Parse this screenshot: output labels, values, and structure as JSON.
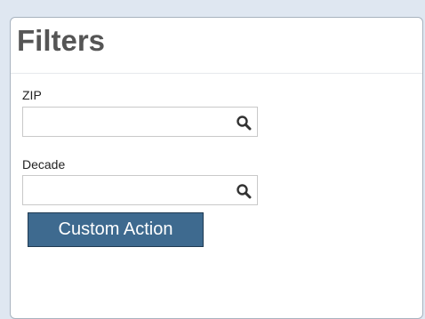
{
  "panel": {
    "title": "Filters"
  },
  "filters": [
    {
      "label": "ZIP",
      "value": "",
      "icon": "search-icon"
    },
    {
      "label": "Decade",
      "value": "",
      "icon": "search-icon"
    }
  ],
  "actions": {
    "custom_label": "Custom Action",
    "button_color": "#3e6a8f"
  }
}
